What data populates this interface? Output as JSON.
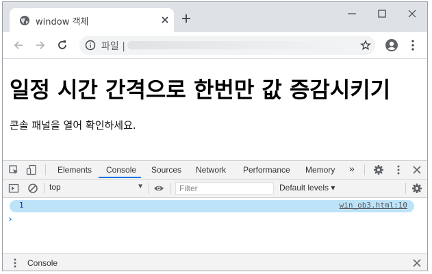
{
  "browser": {
    "tab_title": "window 객체",
    "address_scheme": "파일 |"
  },
  "page": {
    "heading": "일정 시간 간격으로 한번만 값 증감시키기",
    "paragraph": "콘솔 패널을 열어 확인하세요."
  },
  "devtools": {
    "tabs": [
      "Elements",
      "Console",
      "Sources",
      "Network",
      "Performance",
      "Memory"
    ],
    "overflow": "»",
    "context": "top",
    "filter_placeholder": "Filter",
    "levels": "Default levels ▾",
    "messages": [
      {
        "value": "1",
        "source": "win_ob3.html:10"
      }
    ],
    "drawer_tab": "Console"
  },
  "colors": {
    "accent": "#1a73e8",
    "message_highlight": "#bde3f9"
  },
  "icons": [
    "globe-icon",
    "close-icon",
    "plus-icon",
    "minimize-icon",
    "maximize-icon",
    "back-icon",
    "forward-icon",
    "reload-icon",
    "info-icon",
    "star-icon",
    "account-icon",
    "more-icon",
    "inspect-icon",
    "device-icon",
    "settings-icon",
    "sidebar-icon",
    "clear-icon",
    "eye-icon"
  ]
}
